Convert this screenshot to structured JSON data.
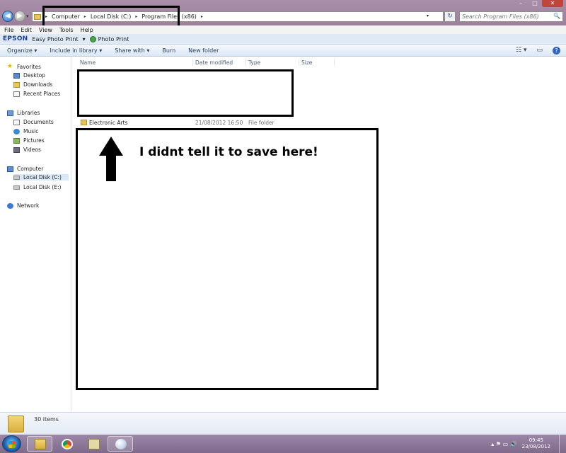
{
  "window": {
    "controls": {
      "minimize": "–",
      "maximize": "□",
      "close": "✕"
    }
  },
  "nav": {
    "back_glyph": "◀",
    "forward_glyph": "▶",
    "dropdown_glyph": "▾"
  },
  "address": {
    "crumbs": [
      "Computer",
      "Local Disk (C:)",
      "Program Files (x86)"
    ],
    "separator": "▸",
    "dropdown_glyph": "▾",
    "refresh_glyph": "↻"
  },
  "search": {
    "placeholder": "Search Program Files (x86)",
    "icon": "search-icon",
    "glyph": "🔍"
  },
  "menubar": [
    "File",
    "Edit",
    "View",
    "Tools",
    "Help"
  ],
  "epson_toolbar": {
    "logo": "EPSON",
    "easy_photo_print": "Easy Photo Print",
    "dropdown_glyph": "▾",
    "photo_print": "Photo Print"
  },
  "commandbar": {
    "organize": "Organize ▾",
    "include_in_library": "Include in library ▾",
    "share_with": "Share with ▾",
    "burn": "Burn",
    "new_folder": "New folder",
    "views_glyph": "☷ ▾",
    "preview_glyph": "▭",
    "help_glyph": "?"
  },
  "navpane": {
    "favorites": "Favorites",
    "desktop": "Desktop",
    "downloads": "Downloads",
    "recent_places": "Recent Places",
    "libraries": "Libraries",
    "documents": "Documents",
    "music": "Music",
    "pictures": "Pictures",
    "videos": "Videos",
    "computer": "Computer",
    "local_disk_c": "Local Disk (C:)",
    "local_disk_e": "Local Disk (E:)",
    "network": "Network"
  },
  "columns": {
    "name": "Name",
    "date_modified": "Date modified",
    "type": "Type",
    "size": "Size"
  },
  "rows": [
    {
      "name": "Electronic Arts",
      "date": "21/08/2012 16:50",
      "type": "File folder",
      "size": ""
    }
  ],
  "annotation": {
    "text": "I didnt tell it to save here!"
  },
  "details": {
    "item_count": "30 items"
  },
  "taskbar": {
    "clock_time": "09:45",
    "clock_date": "23/08/2012",
    "tray_glyphs": "▴  ⚑  ▭  🔊"
  }
}
